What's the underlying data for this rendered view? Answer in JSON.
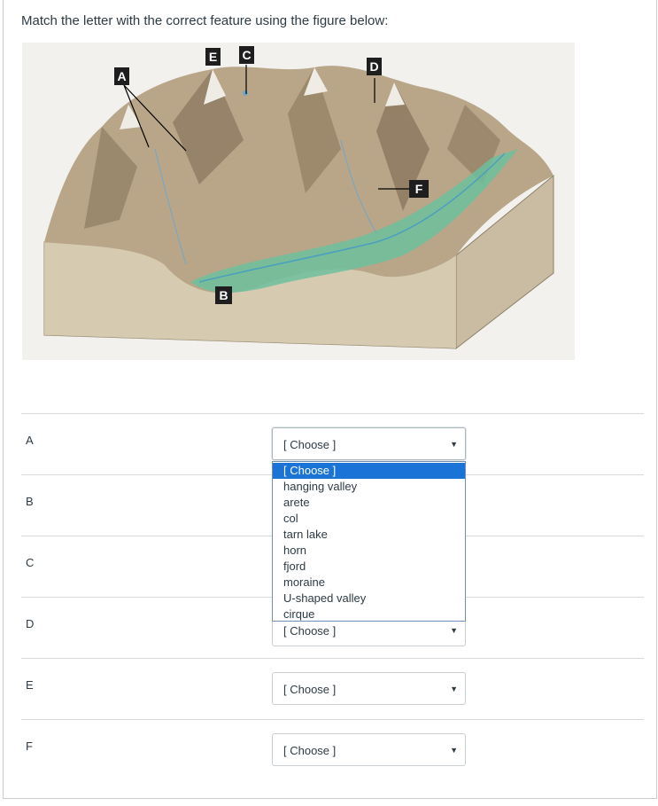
{
  "question": "Match the letter with the correct feature using the figure below:",
  "figure_labels": [
    "A",
    "B",
    "C",
    "D",
    "E",
    "F"
  ],
  "rows": [
    {
      "label": "A",
      "value": "[ Choose ]"
    },
    {
      "label": "B",
      "value": ""
    },
    {
      "label": "C",
      "value": ""
    },
    {
      "label": "D",
      "value": "[ Choose ]"
    },
    {
      "label": "E",
      "value": "[ Choose ]"
    },
    {
      "label": "F",
      "value": "[ Choose ]"
    }
  ],
  "dropdown_options": [
    "[ Choose ]",
    "hanging valley",
    "arete",
    "col",
    "tarn lake",
    "horn",
    "fjord",
    "moraine",
    "U-shaped valley",
    "cirque"
  ],
  "selected_option_index": 0,
  "colors": {
    "highlight": "#1a73d6",
    "rule": "#d6dadd",
    "water": "#6dbf9e"
  }
}
